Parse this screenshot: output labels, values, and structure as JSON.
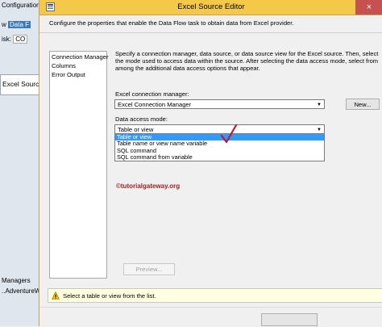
{
  "background": {
    "file_tab": "Configurations.dtsx",
    "row1_prefix": "w",
    "data_flow_tab": "Data F",
    "row2_prefix": "isk:",
    "row2_value": "CO",
    "source_box": "Excel Source",
    "managers": "Managers",
    "adventure": "..AdventureW"
  },
  "dialog": {
    "title": "Excel Source Editor",
    "close_glyph": "×",
    "description": "Configure the properties that enable the Data Flow task to obtain data from Excel provider.",
    "nav_items": [
      "Connection Manager",
      "Columns",
      "Error Output"
    ],
    "right_description": "Specify a connection manager, data source, or data source view for the Excel source. Then, select the mode used to access data within the source. After selecting the data access mode, select from among the additional data access options that appear.",
    "conn_label": "Excel connection manager:",
    "conn_value": "Excel Connection Manager",
    "new_button": "New...",
    "access_label": "Data access mode:",
    "access_value": "Table or view",
    "access_options": [
      "Table or view",
      "Table name or view name variable",
      "SQL command",
      "SQL command from variable"
    ],
    "watermark": "©tutorialgateway.org",
    "preview_button": "Preview...",
    "status_text": "Select a table or view from the list."
  },
  "colors": {
    "titlebar": "#f4c94a",
    "selection": "#3399ff",
    "close": "#c75050",
    "checkmark": "#c0182d"
  },
  "icons": [
    "dialog-icon",
    "close-icon",
    "chevron-down-icon",
    "checkmark-icon",
    "warning-icon"
  ]
}
